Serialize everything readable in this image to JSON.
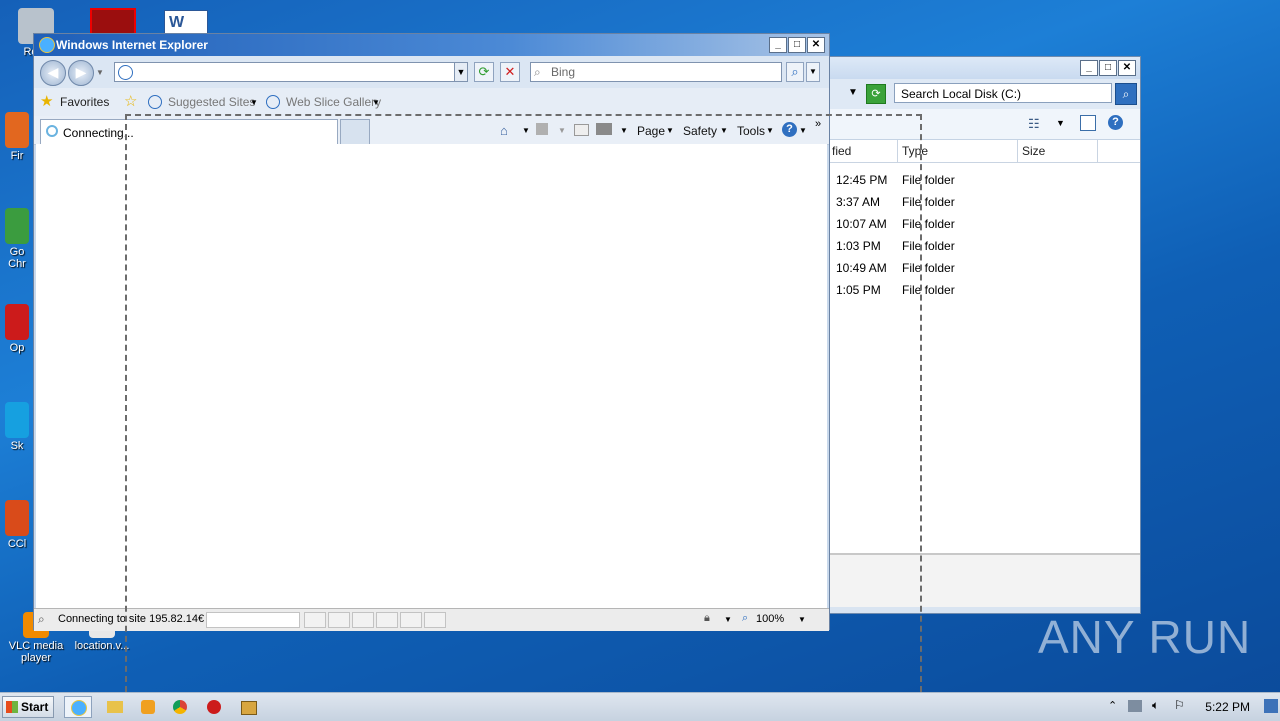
{
  "desktop": {
    "icons": [
      {
        "label": "Recy",
        "color": "#9aa6b4"
      },
      {
        "label": "Fir",
        "color": "#e2671f"
      },
      {
        "label": "Go Chr",
        "color": "#3b9c3f"
      },
      {
        "label": "Op",
        "color": "#cc1b1b"
      },
      {
        "label": "Sk",
        "color": "#16a0e0"
      },
      {
        "label": "CCl",
        "color": "#d94b1a"
      },
      {
        "label": "VLC media player",
        "color": "#f08a00"
      },
      {
        "label": "location.v...",
        "color": "#e8e8e8"
      }
    ]
  },
  "explorer": {
    "search_placeholder": "Search Local Disk (C:)",
    "columns": {
      "modified": "fied",
      "type": "Type",
      "size": "Size"
    },
    "rows": [
      {
        "time": "12:45 PM",
        "type": "File folder"
      },
      {
        "time": "3:37 AM",
        "type": "File folder"
      },
      {
        "time": "10:07 AM",
        "type": "File folder"
      },
      {
        "time": "1:03 PM",
        "type": "File folder"
      },
      {
        "time": "10:49 AM",
        "type": "File folder"
      },
      {
        "time": "1:05 PM",
        "type": "File folder"
      }
    ]
  },
  "ie": {
    "title": "Windows Internet Explorer",
    "address_value": "",
    "search_placeholder": "Bing",
    "favorites_label": "Favorites",
    "suggested_sites": "Suggested Sites",
    "web_slice_gallery": "Web Slice Gallery",
    "tab_label": "Connecting...",
    "menu": {
      "page": "Page",
      "safety": "Safety",
      "tools": "Tools"
    },
    "status_text": "Connecting to site 195.82.14€",
    "zoom": "100%"
  },
  "taskbar": {
    "start_label": "Start",
    "clock": "5:22 PM"
  },
  "watermark": "ANY RUN",
  "colors": {
    "accent": "#1f5fb8",
    "desktop": "#1d7fd6"
  }
}
